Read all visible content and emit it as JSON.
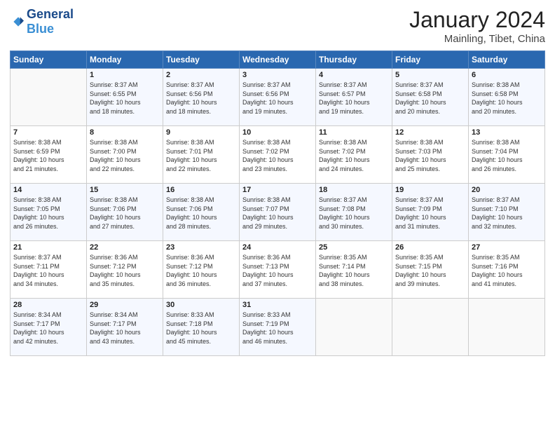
{
  "header": {
    "logo_general": "General",
    "logo_blue": "Blue",
    "month_title": "January 2024",
    "location": "Mainling, Tibet, China"
  },
  "weekdays": [
    "Sunday",
    "Monday",
    "Tuesday",
    "Wednesday",
    "Thursday",
    "Friday",
    "Saturday"
  ],
  "weeks": [
    [
      {
        "day": "",
        "content": ""
      },
      {
        "day": "1",
        "content": "Sunrise: 8:37 AM\nSunset: 6:55 PM\nDaylight: 10 hours\nand 18 minutes."
      },
      {
        "day": "2",
        "content": "Sunrise: 8:37 AM\nSunset: 6:56 PM\nDaylight: 10 hours\nand 18 minutes."
      },
      {
        "day": "3",
        "content": "Sunrise: 8:37 AM\nSunset: 6:56 PM\nDaylight: 10 hours\nand 19 minutes."
      },
      {
        "day": "4",
        "content": "Sunrise: 8:37 AM\nSunset: 6:57 PM\nDaylight: 10 hours\nand 19 minutes."
      },
      {
        "day": "5",
        "content": "Sunrise: 8:37 AM\nSunset: 6:58 PM\nDaylight: 10 hours\nand 20 minutes."
      },
      {
        "day": "6",
        "content": "Sunrise: 8:38 AM\nSunset: 6:58 PM\nDaylight: 10 hours\nand 20 minutes."
      }
    ],
    [
      {
        "day": "7",
        "content": "Sunrise: 8:38 AM\nSunset: 6:59 PM\nDaylight: 10 hours\nand 21 minutes."
      },
      {
        "day": "8",
        "content": "Sunrise: 8:38 AM\nSunset: 7:00 PM\nDaylight: 10 hours\nand 22 minutes."
      },
      {
        "day": "9",
        "content": "Sunrise: 8:38 AM\nSunset: 7:01 PM\nDaylight: 10 hours\nand 22 minutes."
      },
      {
        "day": "10",
        "content": "Sunrise: 8:38 AM\nSunset: 7:02 PM\nDaylight: 10 hours\nand 23 minutes."
      },
      {
        "day": "11",
        "content": "Sunrise: 8:38 AM\nSunset: 7:02 PM\nDaylight: 10 hours\nand 24 minutes."
      },
      {
        "day": "12",
        "content": "Sunrise: 8:38 AM\nSunset: 7:03 PM\nDaylight: 10 hours\nand 25 minutes."
      },
      {
        "day": "13",
        "content": "Sunrise: 8:38 AM\nSunset: 7:04 PM\nDaylight: 10 hours\nand 26 minutes."
      }
    ],
    [
      {
        "day": "14",
        "content": "Sunrise: 8:38 AM\nSunset: 7:05 PM\nDaylight: 10 hours\nand 26 minutes."
      },
      {
        "day": "15",
        "content": "Sunrise: 8:38 AM\nSunset: 7:06 PM\nDaylight: 10 hours\nand 27 minutes."
      },
      {
        "day": "16",
        "content": "Sunrise: 8:38 AM\nSunset: 7:06 PM\nDaylight: 10 hours\nand 28 minutes."
      },
      {
        "day": "17",
        "content": "Sunrise: 8:38 AM\nSunset: 7:07 PM\nDaylight: 10 hours\nand 29 minutes."
      },
      {
        "day": "18",
        "content": "Sunrise: 8:37 AM\nSunset: 7:08 PM\nDaylight: 10 hours\nand 30 minutes."
      },
      {
        "day": "19",
        "content": "Sunrise: 8:37 AM\nSunset: 7:09 PM\nDaylight: 10 hours\nand 31 minutes."
      },
      {
        "day": "20",
        "content": "Sunrise: 8:37 AM\nSunset: 7:10 PM\nDaylight: 10 hours\nand 32 minutes."
      }
    ],
    [
      {
        "day": "21",
        "content": "Sunrise: 8:37 AM\nSunset: 7:11 PM\nDaylight: 10 hours\nand 34 minutes."
      },
      {
        "day": "22",
        "content": "Sunrise: 8:36 AM\nSunset: 7:12 PM\nDaylight: 10 hours\nand 35 minutes."
      },
      {
        "day": "23",
        "content": "Sunrise: 8:36 AM\nSunset: 7:12 PM\nDaylight: 10 hours\nand 36 minutes."
      },
      {
        "day": "24",
        "content": "Sunrise: 8:36 AM\nSunset: 7:13 PM\nDaylight: 10 hours\nand 37 minutes."
      },
      {
        "day": "25",
        "content": "Sunrise: 8:35 AM\nSunset: 7:14 PM\nDaylight: 10 hours\nand 38 minutes."
      },
      {
        "day": "26",
        "content": "Sunrise: 8:35 AM\nSunset: 7:15 PM\nDaylight: 10 hours\nand 39 minutes."
      },
      {
        "day": "27",
        "content": "Sunrise: 8:35 AM\nSunset: 7:16 PM\nDaylight: 10 hours\nand 41 minutes."
      }
    ],
    [
      {
        "day": "28",
        "content": "Sunrise: 8:34 AM\nSunset: 7:17 PM\nDaylight: 10 hours\nand 42 minutes."
      },
      {
        "day": "29",
        "content": "Sunrise: 8:34 AM\nSunset: 7:17 PM\nDaylight: 10 hours\nand 43 minutes."
      },
      {
        "day": "30",
        "content": "Sunrise: 8:33 AM\nSunset: 7:18 PM\nDaylight: 10 hours\nand 45 minutes."
      },
      {
        "day": "31",
        "content": "Sunrise: 8:33 AM\nSunset: 7:19 PM\nDaylight: 10 hours\nand 46 minutes."
      },
      {
        "day": "",
        "content": ""
      },
      {
        "day": "",
        "content": ""
      },
      {
        "day": "",
        "content": ""
      }
    ]
  ]
}
